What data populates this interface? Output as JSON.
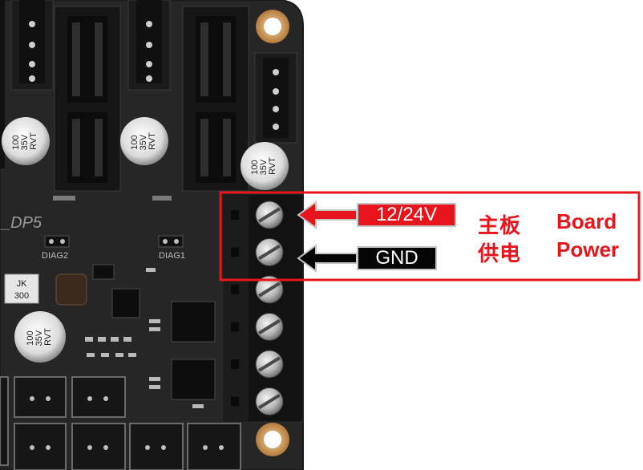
{
  "board": {
    "silkscreen_dp5": "_DP5",
    "silkscreen_diag2": "DIAG2",
    "silkscreen_diag1": "DIAG1",
    "inductor_marking_line1": "JK",
    "inductor_marking_line2": "300",
    "capacitor_marking": [
      "100",
      "35V",
      "RVT"
    ]
  },
  "callout": {
    "vin_label": "12/24V",
    "gnd_label": "GND",
    "chinese_line1": "主板",
    "chinese_line2": "供电",
    "english_line1": "Board",
    "english_line2": "Power",
    "highlight_color": "#e8141c",
    "vin_arrow_color": "#e8141c",
    "gnd_arrow_color": "#050505"
  },
  "terminal_block": {
    "screw_count": 6
  }
}
